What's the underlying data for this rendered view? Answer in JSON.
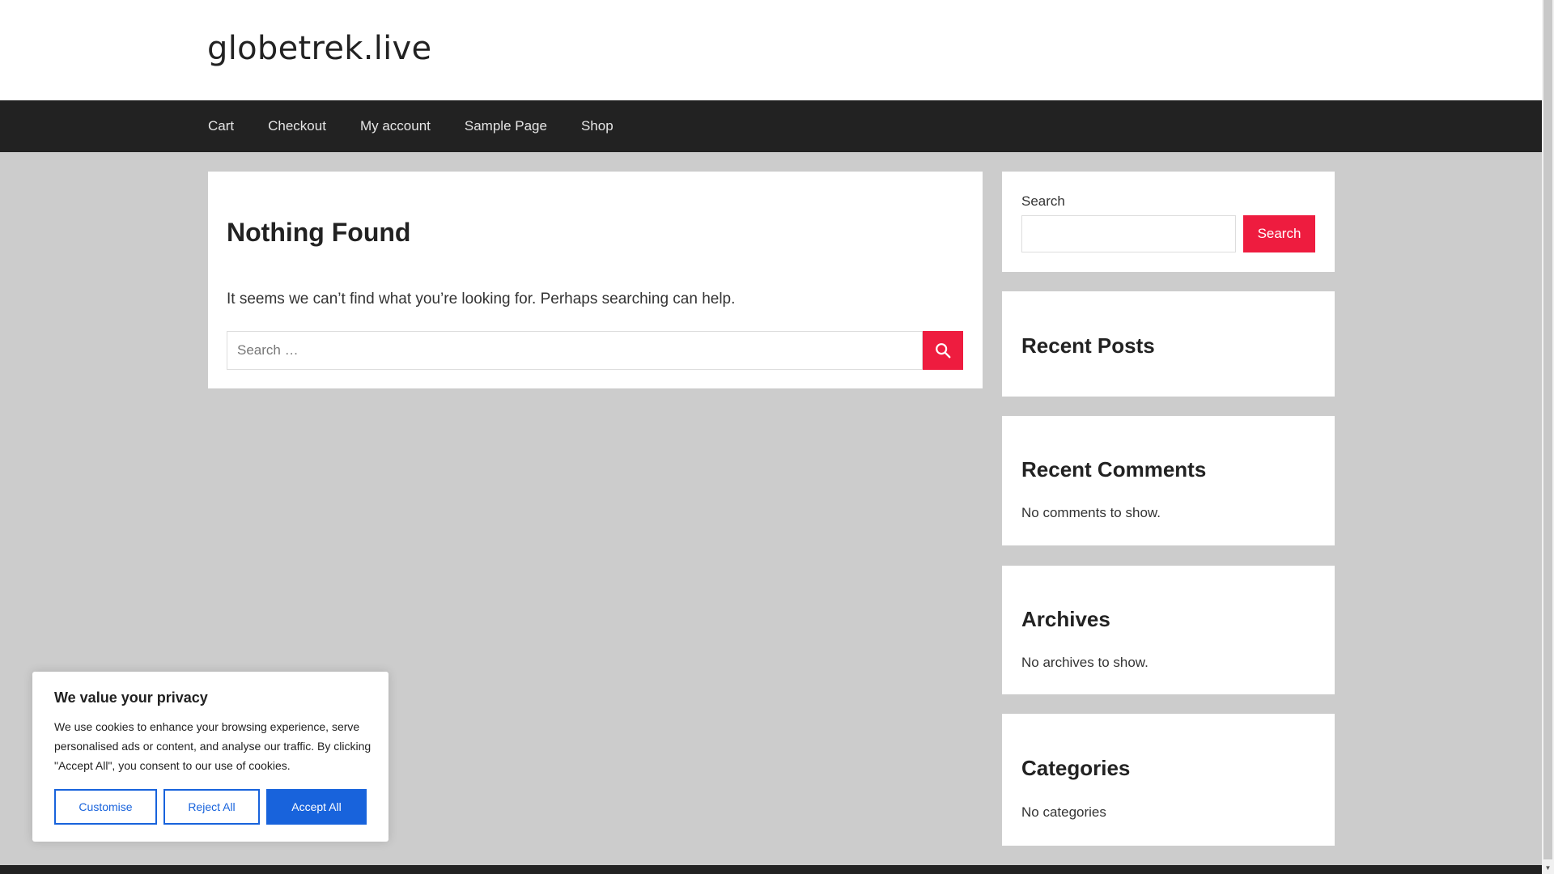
{
  "site": {
    "title": "globetrek.live"
  },
  "nav": {
    "items": [
      {
        "label": "Cart"
      },
      {
        "label": "Checkout"
      },
      {
        "label": "My account"
      },
      {
        "label": "Sample Page"
      },
      {
        "label": "Shop"
      }
    ]
  },
  "main": {
    "title": "Nothing Found",
    "message": "It seems we can’t find what you’re looking for. Perhaps searching can help.",
    "search": {
      "placeholder": "Search …",
      "value": ""
    }
  },
  "sidebar": {
    "search": {
      "label": "Search",
      "button": "Search",
      "value": ""
    },
    "recent_posts": {
      "title": "Recent Posts"
    },
    "recent_comments": {
      "title": "Recent Comments",
      "text": "No comments to show."
    },
    "archives": {
      "title": "Archives",
      "text": "No archives to show."
    },
    "categories": {
      "title": "Categories",
      "text": "No categories"
    }
  },
  "cookie": {
    "title": "We value your privacy",
    "text": "We use cookies to enhance your browsing experience, serve personalised ads or content, and analyse our traffic. By clicking \"Accept All\", you consent to our use of cookies.",
    "customise": "Customise",
    "reject": "Reject All",
    "accept": "Accept All"
  },
  "colors": {
    "accent": "#ee1c3f",
    "nav_bg": "#222222",
    "page_bg": "#cccccc",
    "cookie_blue": "#1863dc"
  },
  "icons": {
    "search_submit": "search-icon"
  }
}
